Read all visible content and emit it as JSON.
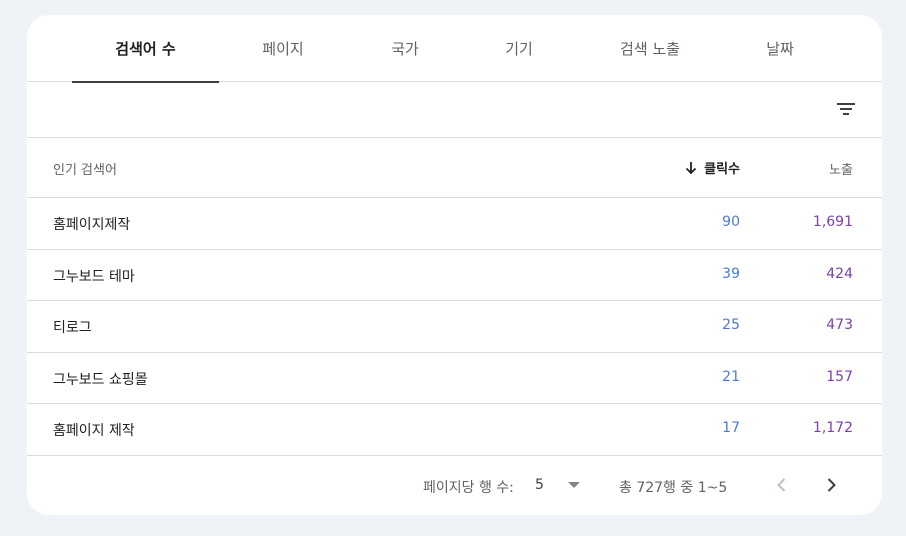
{
  "tabs": [
    {
      "label": "검색어 수",
      "active": true
    },
    {
      "label": "페이지",
      "active": false
    },
    {
      "label": "국가",
      "active": false
    },
    {
      "label": "기기",
      "active": false
    },
    {
      "label": "검색 노출",
      "active": false
    },
    {
      "label": "날짜",
      "active": false
    }
  ],
  "table": {
    "headers": {
      "query": "인기 검색어",
      "clicks": "클릭수",
      "impressions": "노출"
    },
    "sort_icon": "arrow-down-icon",
    "rows": [
      {
        "query": "홈페이지제작",
        "clicks": "90",
        "impressions": "1,691"
      },
      {
        "query": "그누보드 테마",
        "clicks": "39",
        "impressions": "424"
      },
      {
        "query": "티로그",
        "clicks": "25",
        "impressions": "473"
      },
      {
        "query": "그누보드 쇼핑몰",
        "clicks": "21",
        "impressions": "157"
      },
      {
        "query": "홈페이지 제작",
        "clicks": "17",
        "impressions": "1,172"
      }
    ]
  },
  "pagination": {
    "rows_per_page_label": "페이지당 행 수:",
    "rows_per_page_value": "5",
    "range_text": "총 727행 중 1~5"
  },
  "colors": {
    "clicks": "#4a7bd0",
    "impressions": "#7b3fa8",
    "background": "#eff3f8"
  }
}
